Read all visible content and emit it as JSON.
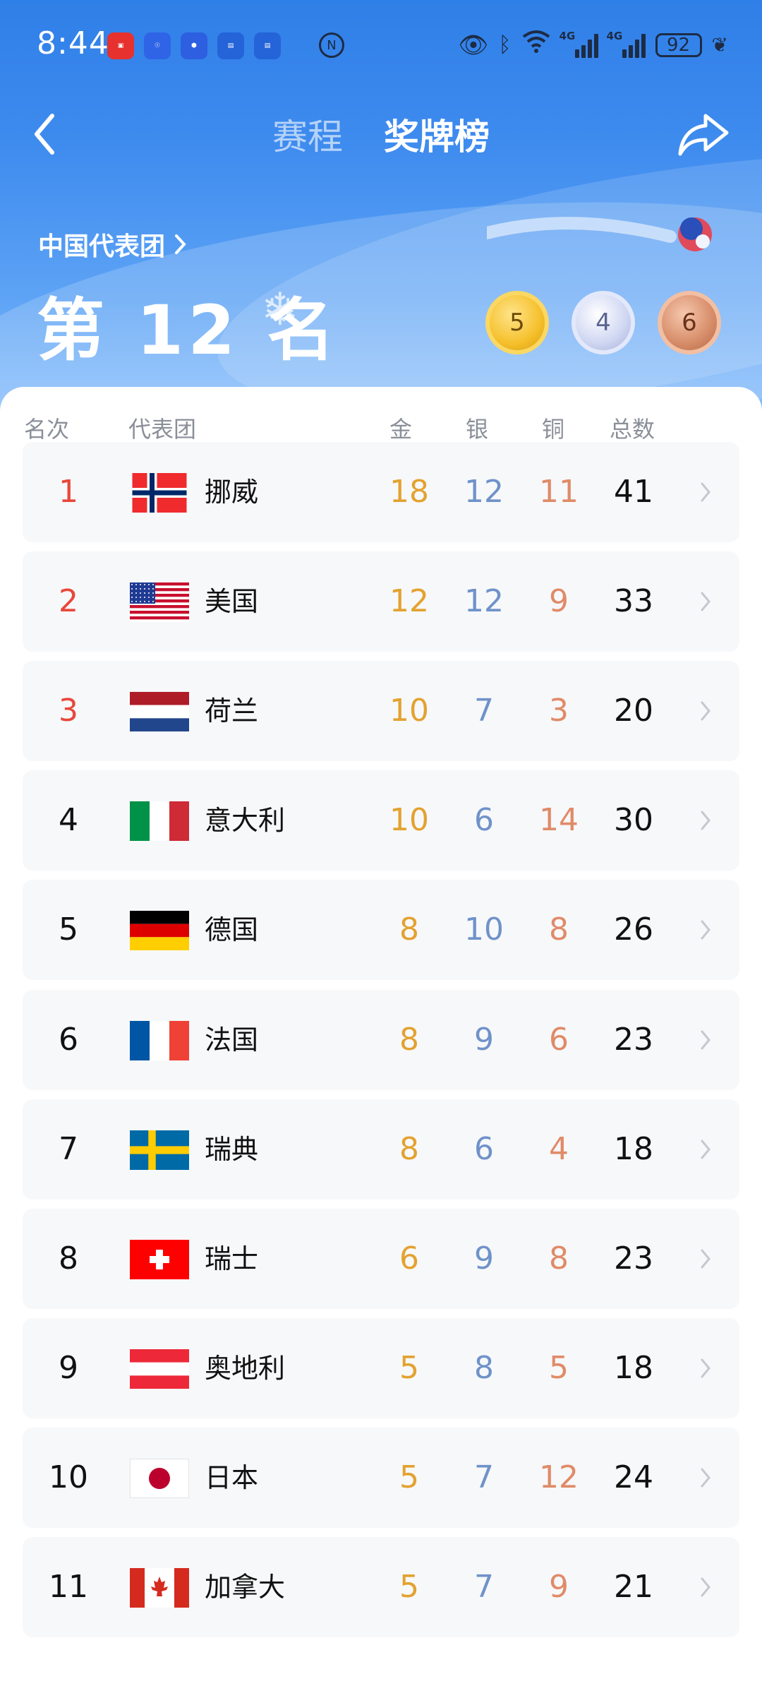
{
  "status_bar": {
    "time": "8:44",
    "battery": "92",
    "net_label": "4G"
  },
  "nav": {
    "tabs": [
      "赛程",
      "奖牌榜"
    ],
    "active_tab": "奖牌榜"
  },
  "summary": {
    "delegation": "中国代表团",
    "rank_text": "第 12 名",
    "gold": "5",
    "silver": "4",
    "bronze": "6"
  },
  "table": {
    "headers": {
      "rank": "名次",
      "delegation": "代表团",
      "gold": "金",
      "silver": "银",
      "bronze": "铜",
      "total": "总数"
    },
    "rows": [
      {
        "rank": "1",
        "country": "挪威",
        "flag": "norway",
        "gold": "18",
        "silver": "12",
        "bronze": "11",
        "total": "41"
      },
      {
        "rank": "2",
        "country": "美国",
        "flag": "usa",
        "gold": "12",
        "silver": "12",
        "bronze": "9",
        "total": "33"
      },
      {
        "rank": "3",
        "country": "荷兰",
        "flag": "netherlands",
        "gold": "10",
        "silver": "7",
        "bronze": "3",
        "total": "20"
      },
      {
        "rank": "4",
        "country": "意大利",
        "flag": "italy",
        "gold": "10",
        "silver": "6",
        "bronze": "14",
        "total": "30"
      },
      {
        "rank": "5",
        "country": "德国",
        "flag": "germany",
        "gold": "8",
        "silver": "10",
        "bronze": "8",
        "total": "26"
      },
      {
        "rank": "6",
        "country": "法国",
        "flag": "france",
        "gold": "8",
        "silver": "9",
        "bronze": "6",
        "total": "23"
      },
      {
        "rank": "7",
        "country": "瑞典",
        "flag": "sweden",
        "gold": "8",
        "silver": "6",
        "bronze": "4",
        "total": "18"
      },
      {
        "rank": "8",
        "country": "瑞士",
        "flag": "switzerland",
        "gold": "6",
        "silver": "9",
        "bronze": "8",
        "total": "23"
      },
      {
        "rank": "9",
        "country": "奥地利",
        "flag": "austria",
        "gold": "5",
        "silver": "8",
        "bronze": "5",
        "total": "18"
      },
      {
        "rank": "10",
        "country": "日本",
        "flag": "japan",
        "gold": "5",
        "silver": "7",
        "bronze": "12",
        "total": "24"
      },
      {
        "rank": "11",
        "country": "加拿大",
        "flag": "canada",
        "gold": "5",
        "silver": "7",
        "bronze": "9",
        "total": "21"
      }
    ]
  },
  "colors": {
    "header_blue": "#3f8cef",
    "gold_text": "#e3a230",
    "silver_text": "#6f92c9",
    "bronze_text": "#e08b68",
    "top_rank": "#e8473b"
  }
}
